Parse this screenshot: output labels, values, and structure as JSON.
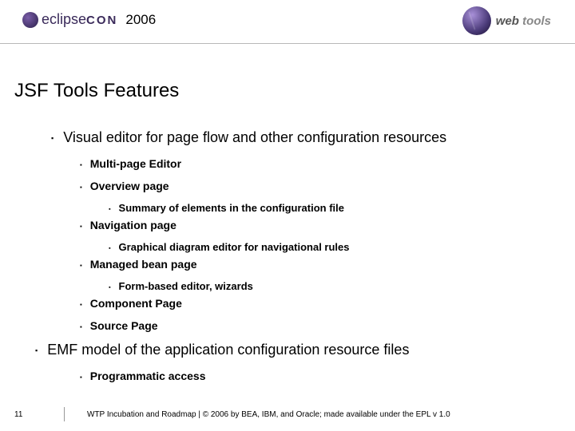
{
  "header": {
    "logo_left_brand": "eclipse",
    "logo_left_suffix": "CON",
    "year": "2006",
    "logo_right_web": "web",
    "logo_right_tools": "tools"
  },
  "title": "JSF Tools Features",
  "bullets": {
    "b1": "Visual editor for page flow and other configuration resources",
    "b1_1": "Multi-page Editor",
    "b1_2": "Overview page",
    "b1_2_1": "Summary of elements in the configuration file",
    "b1_3": "Navigation page",
    "b1_3_1": "Graphical diagram editor for navigational rules",
    "b1_4": "Managed bean page",
    "b1_4_1": "Form-based editor, wizards",
    "b1_5": "Component Page",
    "b1_6": "Source Page",
    "b2": "EMF model of the application configuration resource files",
    "b2_1": "Programmatic access"
  },
  "footer": {
    "page": "11",
    "text": "WTP Incubation and Roadmap  |  © 2006 by BEA, IBM, and Oracle; made available under the EPL v 1.0"
  }
}
